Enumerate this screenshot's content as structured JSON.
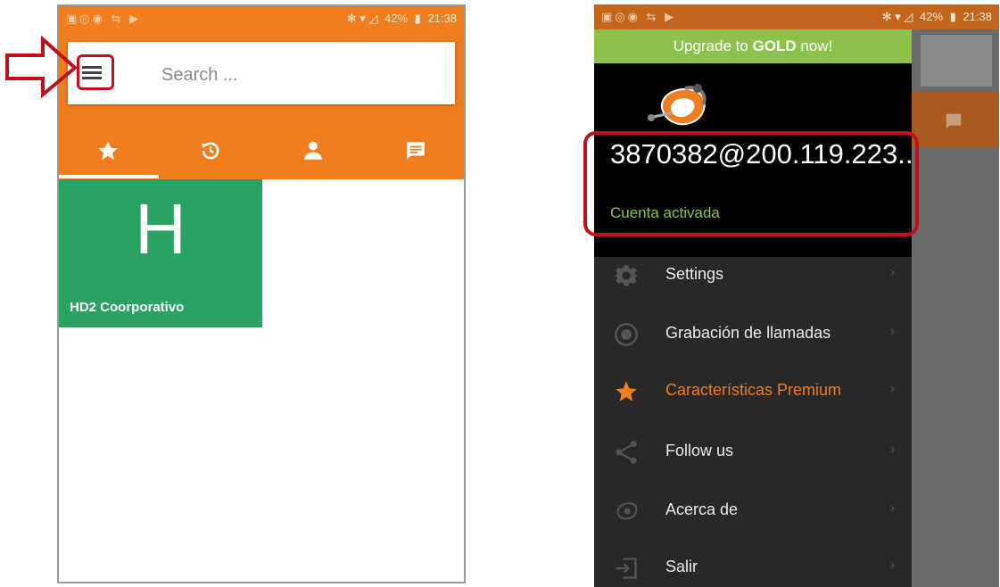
{
  "left_screen": {
    "status_bar": {
      "battery": "42%",
      "time": "21:38"
    },
    "search": {
      "placeholder": "Search ..."
    },
    "tabs": [
      {
        "icon": "star-icon"
      },
      {
        "icon": "history-icon"
      },
      {
        "icon": "person-icon"
      },
      {
        "icon": "message-icon"
      }
    ],
    "contact_tile": {
      "letter": "H",
      "name": "HD2 Coorporativo",
      "color": "#2aa264"
    }
  },
  "right_screen": {
    "status_bar": {
      "battery": "42%",
      "time": "21:38"
    },
    "upgrade_banner": {
      "prefix": "Upgrade to ",
      "bold": "GOLD",
      "suffix": " now!"
    },
    "account": {
      "id": "3870382@200.119.223...",
      "status": "Cuenta activada"
    },
    "menu": [
      {
        "label": "Settings",
        "icon": "gear-icon",
        "chevron": "›"
      },
      {
        "label": "Grabación de llamadas",
        "icon": "record-icon",
        "chevron": "›"
      },
      {
        "label": "Características Premium",
        "icon": "star-icon",
        "chevron": "›"
      },
      {
        "label": "Follow us",
        "icon": "share-icon",
        "chevron": "›"
      },
      {
        "label": "Acerca de",
        "icon": "info-logo-icon",
        "chevron": "›"
      },
      {
        "label": "Salir",
        "icon": "exit-icon",
        "chevron": "›"
      }
    ]
  },
  "colors": {
    "brand_orange": "#f07d1e",
    "accent_green": "#8bc34a",
    "annotation_red": "#c0101a"
  }
}
